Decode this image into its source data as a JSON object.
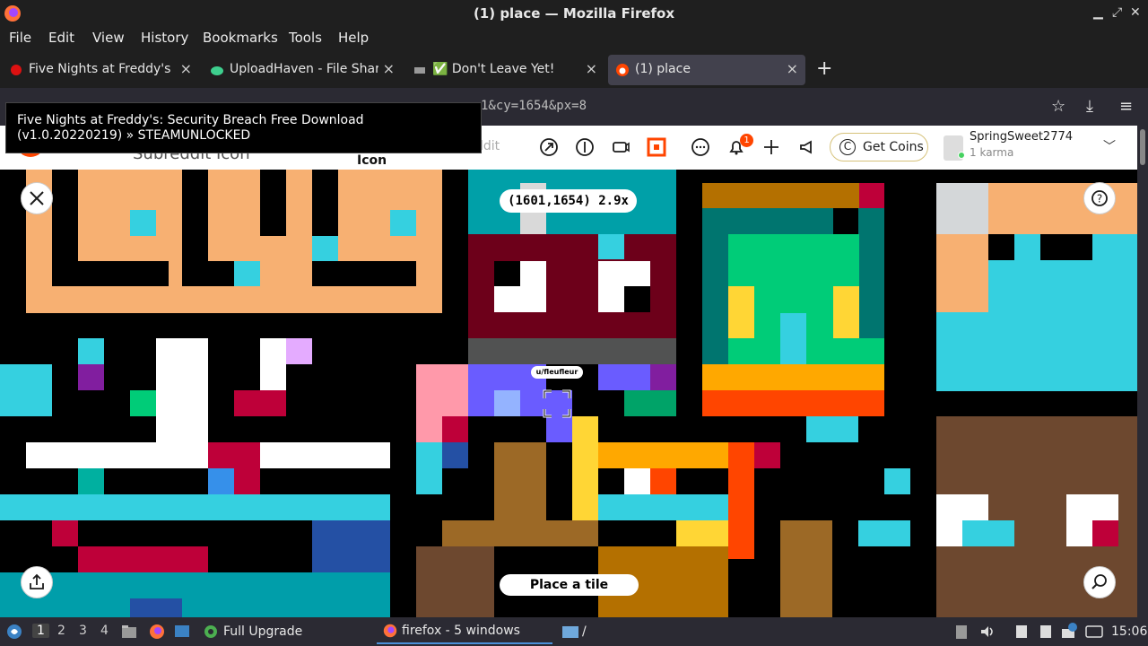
{
  "window": {
    "title": "(1) place — Mozilla Firefox"
  },
  "menu": [
    "File",
    "Edit",
    "View",
    "History",
    "Bookmarks",
    "Tools",
    "Help"
  ],
  "tabs": [
    {
      "label": "Five Nights at Freddy's:",
      "active": false
    },
    {
      "label": "UploadHaven - File Sharin",
      "active": false
    },
    {
      "label": "✅ Don't Leave Yet!",
      "active": false
    },
    {
      "label": "(1) place",
      "active": true
    }
  ],
  "url": {
    "visible_fragment": "1&cy=1654&px=8"
  },
  "tooltip": {
    "text": "Five Nights at Freddy's: Security Breach Free Download (v1.0.20220219) » STEAMUNLOCKED"
  },
  "reddit_header": {
    "subreddit_text": "Subreddit Icon",
    "icon_fragment": "Icon",
    "search_fragment": "ddit",
    "get_coins": "Get Coins",
    "notification_count": "1",
    "username": "SpringSweet2774",
    "karma": "1 karma"
  },
  "canvas": {
    "coordinates": "(1601,1654) 2.9x",
    "user_tag": "u/fleufleur",
    "place_button": "Place a tile"
  },
  "taskbar": {
    "workspaces": [
      "1",
      "2",
      "3",
      "4"
    ],
    "full_upgrade": "Full Upgrade",
    "firefox_task": "firefox - 5 windows",
    "folder_path": "/",
    "clock": "15:06"
  },
  "colors": {
    "reddit_orange": "#ff4500",
    "dark_chrome": "#1f1f1f",
    "active_tab": "#42414d"
  }
}
